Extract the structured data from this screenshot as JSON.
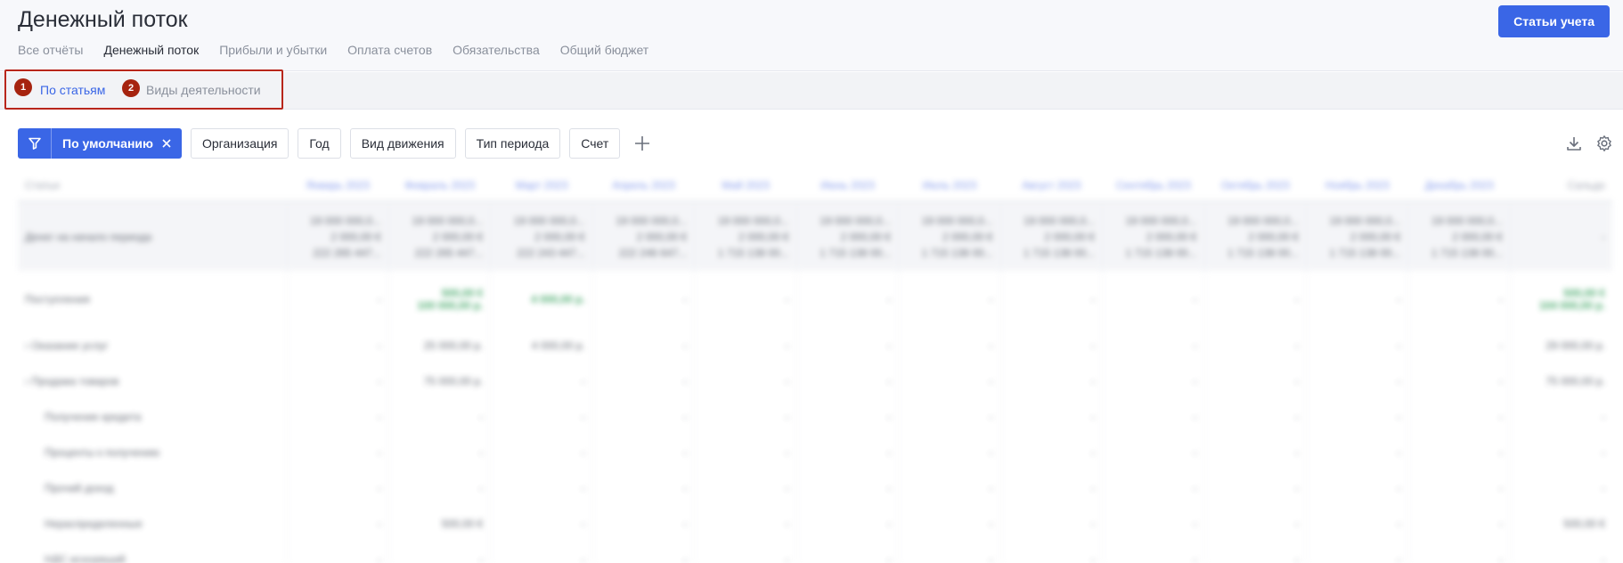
{
  "page": {
    "title": "Денежный поток",
    "accounts_button": "Статьи учета"
  },
  "tabs": [
    "Все отчёты",
    "Денежный поток",
    "Прибыли и убытки",
    "Оплата счетов",
    "Обязательства",
    "Общий бюджет"
  ],
  "subtabs": [
    {
      "marker": "1",
      "label": "По статьям"
    },
    {
      "marker": "2",
      "label": "Виды деятельности"
    }
  ],
  "filters": {
    "default_label": "По умолчанию",
    "chips": [
      "Организация",
      "Год",
      "Вид движения",
      "Тип периода",
      "Счет"
    ]
  },
  "table": {
    "col_first": "Статьи",
    "months": [
      "Январь 2023",
      "Февраль 2023",
      "Март 2023",
      "Апрель 2023",
      "Май 2023",
      "Июнь 2023",
      "Июль 2023",
      "Август 2023",
      "Сентябрь 2023",
      "Октябрь 2023",
      "Ноябрь 2023",
      "Декабрь 2023"
    ],
    "col_total": "Сальдо",
    "start_row": {
      "label": "Денег на начало периода",
      "cells": [
        [
          "19 000 000,0...",
          "2 000,00 €",
          "222 265 447..."
        ],
        [
          "19 000 000,0...",
          "2 000,00 €",
          "222 265 447..."
        ],
        [
          "19 000 000,0...",
          "2 000,00 €",
          "222 243 447..."
        ],
        [
          "19 000 000,0...",
          "2 000,00 €",
          "222 246 647..."
        ],
        [
          "19 000 000,0...",
          "2 000,00 €",
          "1 715 138 00..."
        ],
        [
          "19 000 000,0...",
          "2 000,00 €",
          "1 715 138 00..."
        ],
        [
          "19 000 000,0...",
          "2 000,00 €",
          "1 715 138 00..."
        ],
        [
          "19 000 000,0...",
          "2 000,00 €",
          "1 715 138 00..."
        ],
        [
          "19 000 000,0...",
          "2 000,00 €",
          "1 715 138 00..."
        ],
        [
          "19 000 000,0...",
          "2 000,00 €",
          "1 715 138 00..."
        ],
        [
          "19 000 000,0...",
          "2 000,00 €",
          "1 715 138 00..."
        ],
        [
          "19 000 000,0...",
          "2 000,00 €",
          "1 715 138 00..."
        ]
      ],
      "total": "-"
    },
    "rows": [
      {
        "label": "Поступления",
        "type": "income",
        "cells": [
          "-",
          "500,00 €\n100 000,00 р.",
          "4 000,00 р.",
          "-",
          "-",
          "-",
          "-",
          "-",
          "-",
          "-",
          "-",
          "-"
        ],
        "total": "500,00 €\n104 000,00 р."
      },
      {
        "label": "Оказание услуг",
        "expand": true,
        "cells": [
          "-",
          "25 000,00 р.",
          "4 000,00 р.",
          "-",
          "-",
          "-",
          "-",
          "-",
          "-",
          "-",
          "-",
          "-"
        ],
        "total": "29 000,00 р."
      },
      {
        "label": "Продажа товаров",
        "expand": true,
        "cells": [
          "-",
          "75 000,00 р.",
          "-",
          "-",
          "-",
          "-",
          "-",
          "-",
          "-",
          "-",
          "-",
          "-"
        ],
        "total": "75 000,00 р."
      },
      {
        "label": "Получение кредита",
        "sub": true,
        "cells": [
          "-",
          "-",
          "-",
          "-",
          "-",
          "-",
          "-",
          "-",
          "-",
          "-",
          "-",
          "-"
        ],
        "total": "-"
      },
      {
        "label": "Проценты к получению",
        "sub": true,
        "cells": [
          "-",
          "-",
          "-",
          "-",
          "-",
          "-",
          "-",
          "-",
          "-",
          "-",
          "-",
          "-"
        ],
        "total": "-"
      },
      {
        "label": "Прочий доход",
        "sub": true,
        "cells": [
          "-",
          "-",
          "-",
          "-",
          "-",
          "-",
          "-",
          "-",
          "-",
          "-",
          "-",
          "-"
        ],
        "total": "-"
      },
      {
        "label": "Нераспределенные",
        "sub": true,
        "cells": [
          "-",
          "500,00 €",
          "-",
          "-",
          "-",
          "-",
          "-",
          "-",
          "-",
          "-",
          "-",
          "-"
        ],
        "total": "500,00 €"
      },
      {
        "label": "НДС исходящий",
        "sub": true,
        "cells": [
          "-",
          "-",
          "-",
          "-",
          "-",
          "-",
          "-",
          "-",
          "-",
          "-",
          "-",
          "-"
        ],
        "total": "-"
      }
    ]
  }
}
